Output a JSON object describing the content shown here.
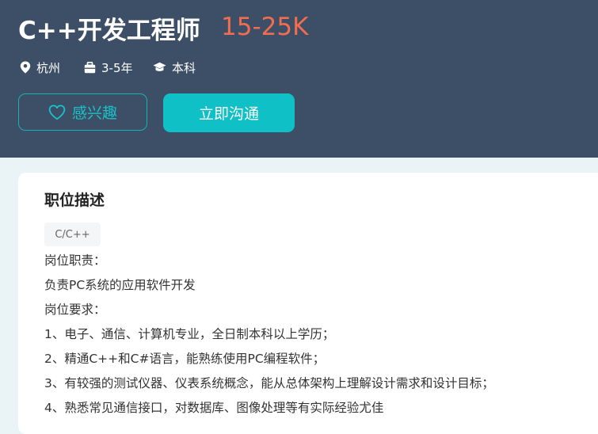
{
  "job": {
    "title": "C++开发工程师",
    "salary": "15-25K",
    "location": "杭州",
    "experience": "3-5年",
    "education": "本科"
  },
  "actions": {
    "favorite_label": "感兴趣",
    "chat_label": "立即沟通"
  },
  "description": {
    "heading": "职位描述",
    "tag": "C/C++",
    "lines": [
      "岗位职责：",
      "负责PC系统的应用软件开发",
      "岗位要求：",
      "1、电子、通信、计算机专业，全日制本科以上学历；",
      "2、精通C++和C#语言，能熟练使用PC编程软件；",
      "3、有较强的测试仪器、仪表系统概念，能从总体架构上理解设计需求和设计目标；",
      "4、熟悉常见通信接口，对数据库、图像处理等有实际经验尤佳"
    ]
  },
  "colors": {
    "header_bg": "#3c4f66",
    "salary": "#f26d4f",
    "accent": "#0fc0c6"
  },
  "icons": [
    "location-pin-icon",
    "briefcase-icon",
    "graduation-cap-icon",
    "heart-icon"
  ]
}
